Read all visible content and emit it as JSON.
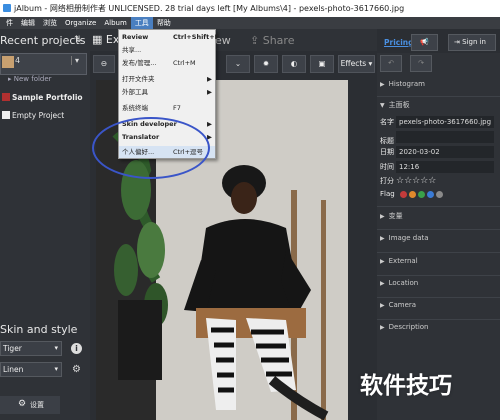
{
  "window": {
    "title": "jAlbum - 网络相册制作者 UNLICENSED. 28 trial days left [My Albums\\4] - pexels-photo-3617660.jpg"
  },
  "menubar": {
    "items": [
      "件",
      "编辑",
      "浏览",
      "Organize",
      "Album",
      "工具",
      "帮助"
    ]
  },
  "tools_menu": {
    "items": [
      {
        "label": "Review",
        "shortcut": "Ctrl+Shift+F",
        "bold": true
      },
      {
        "label": "共享...",
        "shortcut": ""
      },
      {
        "label": "发布/管理...",
        "shortcut": "Ctrl+M"
      },
      {
        "label": "打开文件夹",
        "shortcut": "",
        "submenu": true
      },
      {
        "label": "外部工具",
        "shortcut": "",
        "submenu": true
      },
      {
        "label": "系统终端",
        "shortcut": "F7"
      },
      {
        "label": "Skin developer",
        "shortcut": "",
        "submenu": true,
        "bold": true
      },
      {
        "label": "Translator",
        "shortcut": "",
        "submenu": true,
        "bold": true
      },
      {
        "label": "个人偏好...",
        "shortcut": "Ctrl+逗号"
      }
    ]
  },
  "left": {
    "recent_title": "Recent projects",
    "sort_icon": "sort-icon",
    "project_number": "4",
    "new_folder": "New folder",
    "items": [
      {
        "label": "Sample Portfolio"
      },
      {
        "label": "Empty Project"
      }
    ],
    "skin_title": "Skin and style",
    "skin_value": "Tiger",
    "style_value": "Linen",
    "settings_label": "设置"
  },
  "center": {
    "tab_explore": "Ex",
    "tab_view": "ew",
    "tab_share": "Share",
    "effects_label": "Effects"
  },
  "right": {
    "pricing": "Pricing",
    "sign_in": "Sign in",
    "sections": {
      "histogram": "Histogram",
      "main": "主面板",
      "variables": "变量",
      "image_data": "Image data",
      "external": "External",
      "location": "Location",
      "camera": "Camera",
      "description": "Description"
    },
    "meta": {
      "name_label": "名字",
      "name_value": "pexels-photo-3617660.jpg",
      "title_label": "标题",
      "title_value": "",
      "date_label": "日期",
      "date_value": "2020-03-02",
      "time_label": "时间",
      "time_value": "12:16",
      "rating_label": "打分",
      "rating_stars": "☆☆☆☆☆",
      "flag_label": "Flag"
    },
    "flag_colors": [
      "#c23b3b",
      "#e0892c",
      "#3aa14a",
      "#3a7bd5",
      "#8a8a8a"
    ]
  },
  "watermark": "软件技巧"
}
